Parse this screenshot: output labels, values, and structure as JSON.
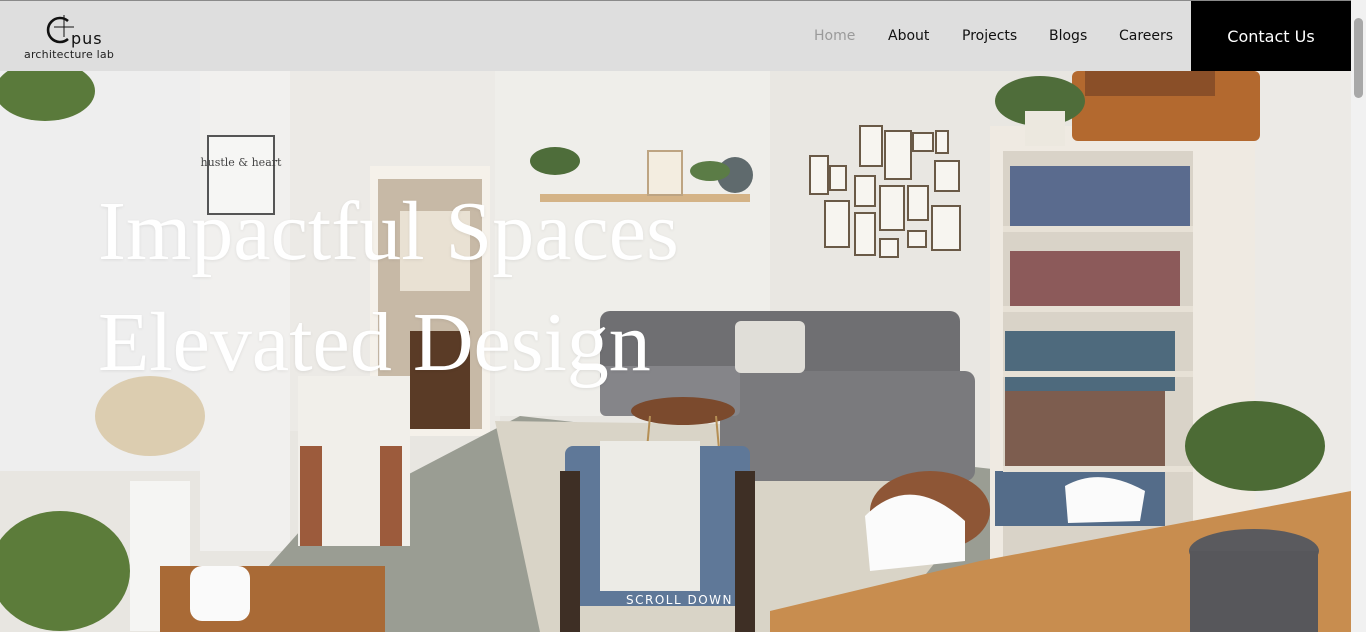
{
  "brand": {
    "name": "pus",
    "subtitle": "architecture lab"
  },
  "nav": {
    "items": [
      {
        "label": "Home",
        "active": true
      },
      {
        "label": "About"
      },
      {
        "label": "Projects"
      },
      {
        "label": "Blogs"
      },
      {
        "label": "Careers"
      }
    ],
    "contact_label": "Contact Us"
  },
  "hero": {
    "title_line1": "Impactful Spaces",
    "title_line2": "Elevated Design",
    "scroll_label": "SCROLL DOWN",
    "wall_sign": "hustle & heart"
  },
  "colors": {
    "header_bg": "#dedede",
    "contact_bg": "#000000",
    "active_nav": "#9a9a9a",
    "hero_text": "#ffffff"
  }
}
